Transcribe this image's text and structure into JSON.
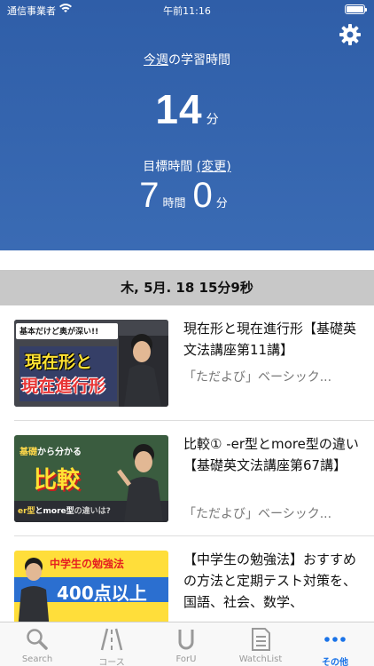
{
  "status_bar": {
    "carrier": "通信事業者",
    "time": "午前11:16"
  },
  "header": {
    "week_label_link": "今週",
    "week_label_rest": "の学習時間",
    "week_minutes": "14",
    "minutes_unit": "分",
    "goal_label": "目標時間",
    "goal_change_link": "(変更)",
    "goal_hours": "7",
    "hours_unit": "時間",
    "goal_minutes": "0",
    "goal_minutes_unit": "分"
  },
  "date_bar": "木, 5月. 18 15分9秒",
  "lessons": [
    {
      "title": "現在形と現在進行形【基礎英文法講座第11講】",
      "subtitle": "「ただよび」ベーシック...",
      "thumb": {
        "caption": "基本だけど奥が深い!!",
        "line1": "現在形と",
        "line2": "現在進行形"
      }
    },
    {
      "title": "比較① -er型とmore型の違い【基礎英文法講座第67講】",
      "subtitle": "「ただよび」ベーシック...",
      "thumb": {
        "caption_a": "基礎",
        "caption_b": "から分かる",
        "main": "比較",
        "footer_a": "er型",
        "footer_b": "とmore型",
        "footer_c": "の違いは?"
      }
    },
    {
      "title": "【中学生の勉強法】おすすめの方法と定期テスト対策を、国語、社会、数学、",
      "subtitle": "",
      "thumb": {
        "caption": "中学生の勉強法",
        "main": "400点以上"
      }
    }
  ],
  "tabs": [
    {
      "label": "Search",
      "icon": "search-icon",
      "active": false
    },
    {
      "label": "コース",
      "icon": "road-icon",
      "active": false
    },
    {
      "label": "ForU",
      "icon": "foru-icon",
      "active": false
    },
    {
      "label": "WatchList",
      "icon": "document-icon",
      "active": false
    },
    {
      "label": "その他",
      "icon": "more-icon",
      "active": true
    }
  ],
  "colors": {
    "header_bg": "#3a6bb4",
    "active_tab": "#1a73e8",
    "date_bar_bg": "#c8c8c8"
  }
}
